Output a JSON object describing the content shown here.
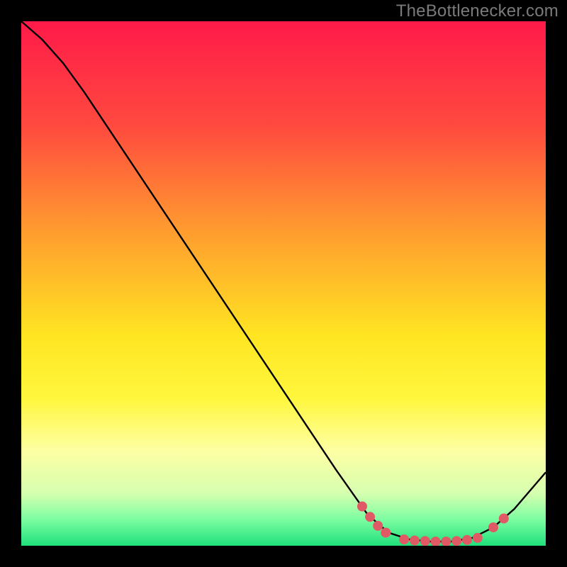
{
  "page": {
    "watermark": "TheBottlenecker.com"
  },
  "chart_data": {
    "type": "line",
    "title": "",
    "xlabel": "",
    "ylabel": "",
    "xlim": [
      0,
      100
    ],
    "ylim": [
      0,
      100
    ],
    "grid": false,
    "background": {
      "type": "vertical-gradient",
      "stops": [
        {
          "pos": 0.0,
          "color": "#ff1a49"
        },
        {
          "pos": 0.2,
          "color": "#ff4a3f"
        },
        {
          "pos": 0.4,
          "color": "#ff9c2f"
        },
        {
          "pos": 0.6,
          "color": "#ffe522"
        },
        {
          "pos": 0.72,
          "color": "#fff73e"
        },
        {
          "pos": 0.82,
          "color": "#fdffa4"
        },
        {
          "pos": 0.9,
          "color": "#d6ffb0"
        },
        {
          "pos": 0.95,
          "color": "#7cfda1"
        },
        {
          "pos": 1.0,
          "color": "#1fe07c"
        }
      ]
    },
    "series": [
      {
        "name": "curve",
        "color": "#000000",
        "points": [
          {
            "x": 0.0,
            "y": 100.0
          },
          {
            "x": 4.0,
            "y": 96.5
          },
          {
            "x": 8.0,
            "y": 92.0
          },
          {
            "x": 12.0,
            "y": 86.5
          },
          {
            "x": 20.0,
            "y": 74.5
          },
          {
            "x": 30.0,
            "y": 59.5
          },
          {
            "x": 40.0,
            "y": 44.5
          },
          {
            "x": 50.0,
            "y": 29.5
          },
          {
            "x": 60.0,
            "y": 14.5
          },
          {
            "x": 66.0,
            "y": 6.0
          },
          {
            "x": 70.0,
            "y": 2.5
          },
          {
            "x": 74.0,
            "y": 1.2
          },
          {
            "x": 78.0,
            "y": 0.8
          },
          {
            "x": 82.0,
            "y": 0.8
          },
          {
            "x": 86.0,
            "y": 1.5
          },
          {
            "x": 90.0,
            "y": 3.5
          },
          {
            "x": 94.0,
            "y": 7.0
          },
          {
            "x": 100.0,
            "y": 14.0
          }
        ]
      }
    ],
    "markers": {
      "color": "#e05a66",
      "radius_px": 7,
      "points": [
        {
          "x": 65.0,
          "y": 7.5
        },
        {
          "x": 66.5,
          "y": 5.5
        },
        {
          "x": 68.0,
          "y": 3.8
        },
        {
          "x": 69.5,
          "y": 2.5
        },
        {
          "x": 73.0,
          "y": 1.2
        },
        {
          "x": 75.0,
          "y": 1.0
        },
        {
          "x": 77.0,
          "y": 0.9
        },
        {
          "x": 79.0,
          "y": 0.8
        },
        {
          "x": 81.0,
          "y": 0.8
        },
        {
          "x": 83.0,
          "y": 0.9
        },
        {
          "x": 85.0,
          "y": 1.1
        },
        {
          "x": 87.0,
          "y": 1.5
        },
        {
          "x": 90.0,
          "y": 3.5
        },
        {
          "x": 92.0,
          "y": 5.2
        }
      ]
    }
  }
}
